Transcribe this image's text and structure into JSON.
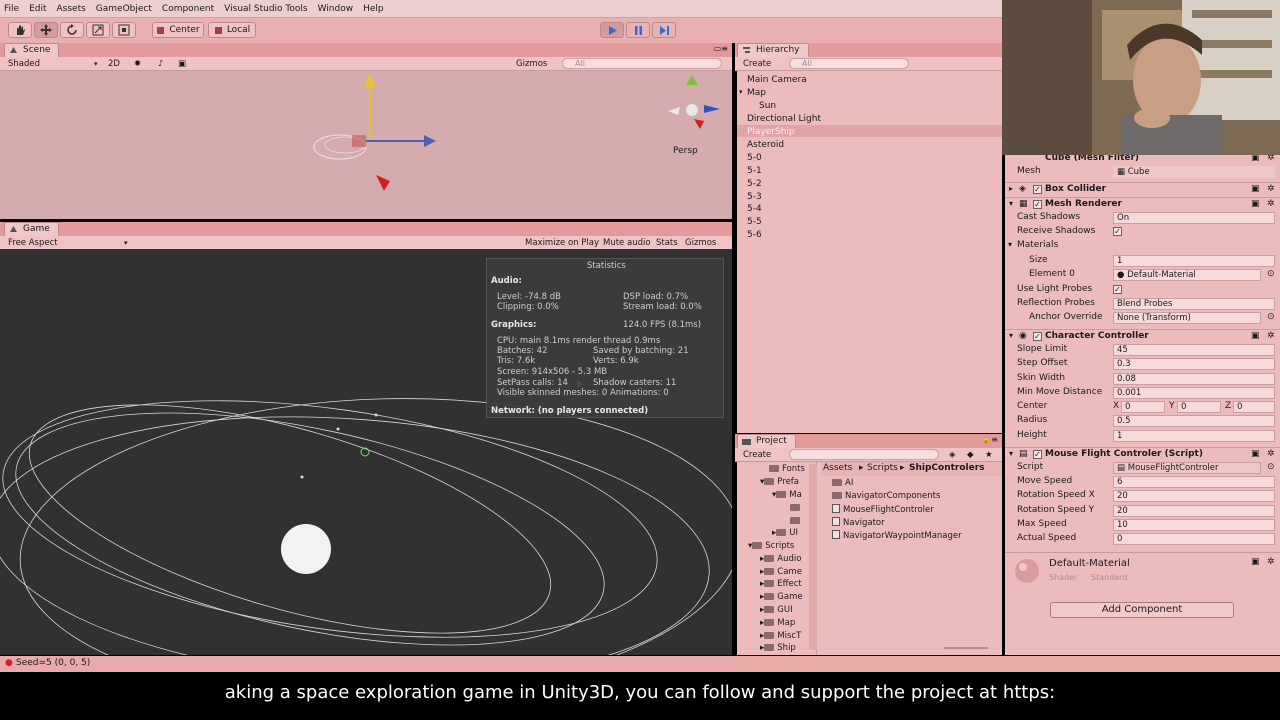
{
  "menu": [
    "File",
    "Edit",
    "Assets",
    "GameObject",
    "Component",
    "Visual Studio Tools",
    "Window",
    "Help"
  ],
  "toolbar": {
    "pivot_label": "Center",
    "space_label": "Local"
  },
  "scene": {
    "tab_label": "Scene",
    "shading": "Shaded",
    "mode_2d": "2D",
    "gizmos": "Gizmos",
    "search_placeholder": "All",
    "persp_label": "Persp"
  },
  "game": {
    "tab_label": "Game",
    "aspect": "Free Aspect",
    "maximize": "Maximize on Play",
    "mute": "Mute audio",
    "stats": "Stats",
    "gizmos": "Gizmos"
  },
  "statistics": {
    "title": "Statistics",
    "audio_head": "Audio:",
    "level": "Level: -74.8 dB",
    "clipping": "Clipping: 0.0%",
    "dsp": "DSP load: 0.7%",
    "stream": "Stream load: 0.0%",
    "graphics_head": "Graphics:",
    "fps": "124.0 FPS (8.1ms)",
    "cpu": "CPU: main 8.1ms  render thread 0.9ms",
    "batches": "Batches: 42",
    "saved": "Saved by batching: 21",
    "tris": "Tris: 7.6k",
    "verts": "Verts: 6.9k",
    "screen": "Screen: 914x506 - 5.3 MB",
    "setpass": "SetPass calls: 14",
    "shadow": "Shadow casters: 11",
    "skinned": "Visible skinned meshes: 0  Animations: 0",
    "network": "Network: (no players connected)"
  },
  "hierarchy": {
    "tab_label": "Hierarchy",
    "create": "Create",
    "search_placeholder": "All",
    "items": [
      "Main Camera",
      "Map",
      "Sun",
      "Directional Light",
      "PlayerShip",
      "Asteroid",
      "5-0",
      "5-1",
      "5-2",
      "5-3",
      "5-4",
      "5-5",
      "5-6"
    ]
  },
  "project": {
    "tab_label": "Project",
    "create": "Create",
    "breadcrumb": [
      "Assets",
      "Scripts",
      "ShipControlers"
    ],
    "tree": [
      "Fonts",
      "Prefa",
      "Ma",
      "UI",
      "Scripts",
      "Audio",
      "Came",
      "Effect",
      "Game",
      "GUI",
      "Map",
      "MiscT",
      "Ship"
    ],
    "files": [
      "AI",
      "NavigatorComponents",
      "MouseFlightControler",
      "Navigator",
      "NavigatorWaypointManager"
    ]
  },
  "inspector": {
    "mesh_filter_title": "Cube (Mesh Filter)",
    "mesh_label": "Mesh",
    "mesh_value": "Cube",
    "box_collider": "Box Collider",
    "mesh_renderer": "Mesh Renderer",
    "cast_shadows_label": "Cast Shadows",
    "cast_shadows_value": "On",
    "receive_shadows_label": "Receive Shadows",
    "materials_label": "Materials",
    "size_label": "Size",
    "size_value": "1",
    "element0_label": "Element 0",
    "element0_value": "Default-Material",
    "light_probes_label": "Use Light Probes",
    "reflection_label": "Reflection Probes",
    "reflection_value": "Blend Probes",
    "anchor_label": "Anchor Override",
    "anchor_value": "None (Transform)",
    "char_controller": "Character Controller",
    "slope_label": "Slope Limit",
    "slope_value": "45",
    "step_label": "Step Offset",
    "step_value": "0.3",
    "skin_label": "Skin Width",
    "skin_value": "0.08",
    "minmove_label": "Min Move Distance",
    "minmove_value": "0.001",
    "center_label": "Center",
    "center_x_label": "X",
    "center_x": "0",
    "center_y_label": "Y",
    "center_y": "0",
    "center_z_label": "Z",
    "center_z": "0",
    "radius_label": "Radius",
    "radius_value": "0.5",
    "height_label": "Height",
    "height_value": "1",
    "mouse_flight": "Mouse Flight Controler (Script)",
    "script_label": "Script",
    "script_value": "MouseFlightControler",
    "move_speed_label": "Move Speed",
    "move_speed_value": "6",
    "rotx_label": "Rotation Speed X",
    "rotx_value": "20",
    "roty_label": "Rotation Speed Y",
    "roty_value": "20",
    "maxspeed_label": "Max Speed",
    "maxspeed_value": "10",
    "actual_label": "Actual Speed",
    "actual_value": "0",
    "material_name": "Default-Material",
    "shader_label": "Shader",
    "shader_value": "Standard",
    "add_component": "Add Component"
  },
  "status": {
    "text": "Seed=5 (0, 0, 5)"
  },
  "subtitle": "aking a space exploration game in Unity3D, you can follow and support the project at https:"
}
